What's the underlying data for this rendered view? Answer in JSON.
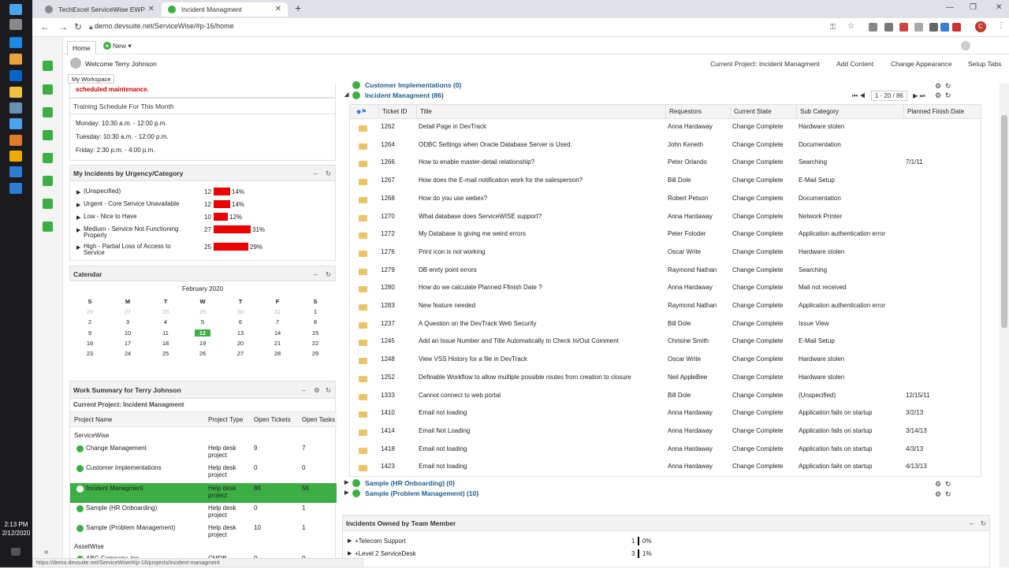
{
  "browser": {
    "tabs": [
      {
        "label": "TechExcel ServiceWise EWP",
        "active": false
      },
      {
        "label": "Incident Managment",
        "active": true
      }
    ],
    "url": "demo.devsuite.net/ServiceWise/#p-16/home",
    "profile_initial": "C"
  },
  "taskbar": {
    "time": "2:13 PM",
    "date": "2/12/2020"
  },
  "app": {
    "home_tab": "Home",
    "new_button": "New",
    "welcome": "Welcome Terry Johnson",
    "workspace_tab": "My Workspace",
    "links": {
      "current_project": "Current Project: Incident Managment",
      "add_content": "Add Content",
      "change_appearance": "Change Appearance",
      "setup_tabs": "Setup Tabs"
    }
  },
  "left": {
    "maintenance": "scheduled maintenance.",
    "training": {
      "title": "Training Schedule For This Month",
      "items": [
        "Monday: 10:30 a.m. - 12:00 p.m.",
        "Tuesday: 10:30 a.m. - 12:00 p.m.",
        "Friday: 2:30 p.m. - 4:00 p.m."
      ]
    },
    "urgency": {
      "title": "My Incidents by Urgency/Category",
      "rows": [
        {
          "label": "(Unspecified)",
          "count": "12",
          "pct": "14%",
          "value": 14
        },
        {
          "label": "Urgent - Core Service Unavailable",
          "count": "12",
          "pct": "14%",
          "value": 14
        },
        {
          "label": "Low - Nice to Have",
          "count": "10",
          "pct": "12%",
          "value": 12
        },
        {
          "label": "Medium - Service Not Functioning Properly",
          "count": "27",
          "pct": "31%",
          "value": 31
        },
        {
          "label": "High - Partial Loss of Access to Service",
          "count": "25",
          "pct": "29%",
          "value": 29
        }
      ]
    },
    "calendar": {
      "title": "Calendar",
      "month": "February 2020",
      "days": [
        "S",
        "M",
        "T",
        "W",
        "T",
        "F",
        "S"
      ],
      "weeks": [
        [
          "26",
          "27",
          "28",
          "29",
          "30",
          "31",
          "1"
        ],
        [
          "2",
          "3",
          "4",
          "5",
          "6",
          "7",
          "8"
        ],
        [
          "9",
          "10",
          "11",
          "12",
          "13",
          "14",
          "15"
        ],
        [
          "16",
          "17",
          "18",
          "19",
          "20",
          "21",
          "22"
        ],
        [
          "23",
          "24",
          "25",
          "26",
          "27",
          "28",
          "29"
        ]
      ],
      "today": "12"
    },
    "work": {
      "title": "Work Summary for Terry Johnson",
      "current": "Current Project: Incident Managment",
      "headers": [
        "Project Name",
        "Project Type",
        "Open Tickets",
        "Open Tasks"
      ],
      "group1": "ServiceWise",
      "rows": [
        {
          "name": "Change Management",
          "type": "Help desk project",
          "tickets": "9",
          "tasks": "7"
        },
        {
          "name": "Customer Implementations",
          "type": "Help desk project",
          "tickets": "0",
          "tasks": "0"
        },
        {
          "name": "Incident Managment",
          "type": "Help desk project",
          "tickets": "86",
          "tasks": "56"
        },
        {
          "name": "Sample (HR Onboarding)",
          "type": "Help desk project",
          "tickets": "0",
          "tasks": "1"
        },
        {
          "name": "Sample (Problem Management)",
          "type": "Help desk project",
          "tickets": "10",
          "tasks": "1"
        }
      ],
      "group2": "AssetWise",
      "row_asset": {
        "name": "ABC Company, Inc",
        "type": "CMDB",
        "tickets": "0",
        "tasks": "0"
      }
    }
  },
  "main": {
    "projects_top": [
      "Customer Implementations (0)",
      "Incident Managment (86)"
    ],
    "pager": "1 - 20 / 86",
    "columns": [
      "Ticket ID",
      "Title",
      "Requestors",
      "Current State",
      "Sub Category",
      "Planned Finish Date"
    ],
    "rows": [
      [
        "1262",
        "Detail Page in DevTrack",
        "Anna Hardaway",
        "Change Complete",
        "Hardware stolen",
        ""
      ],
      [
        "1264",
        "ODBC Settings when Oracle Database Server is Used.",
        "John Keneth",
        "Change Complete",
        "Documentation",
        ""
      ],
      [
        "1266",
        "How to enable master-detail relationship?",
        "Peter Orlando",
        "Change Complete",
        "Searching",
        "7/1/11"
      ],
      [
        "1267",
        "How does the E-mail notification work for the salesperson?",
        "Bill Dole",
        "Change Complete",
        "E-Mail Setup",
        ""
      ],
      [
        "1268",
        "How do you use webex?",
        "Robert Petson",
        "Change Complete",
        "Documentation",
        ""
      ],
      [
        "1270",
        "What database does ServiceWISE support?",
        "Anna Hardaway",
        "Change Complete",
        "Network Printer",
        ""
      ],
      [
        "1272",
        "My Database is giving me weird errors",
        "Peter Foloder",
        "Change Complete",
        "Application authentication error",
        ""
      ],
      [
        "1276",
        "Print icon is not working",
        "Oscar Write",
        "Change Complete",
        "Hardware stolen",
        ""
      ],
      [
        "1279",
        "DB enrty point errors",
        "Raymond Nathan",
        "Change Complete",
        "Searching",
        ""
      ],
      [
        "1280",
        "How do we calculate Planned Ffinish Date ?",
        "Anna Hardaway",
        "Change Complete",
        "Mail not received",
        ""
      ],
      [
        "1283",
        "New feature needed",
        "Raymond Nathan",
        "Change Complete",
        "Application authentication error",
        ""
      ],
      [
        "1237",
        "A Question on the DevTrack Web Security",
        "Bill Dole",
        "Change Complete",
        "Issue View",
        ""
      ],
      [
        "1245",
        "Add an Issue Number and Title Automatically to Check In/Out Comment",
        "Chrisine Smith",
        "Change Complete",
        "E-Mail Setup",
        ""
      ],
      [
        "1248",
        "View VSS History for a file in DevTrack",
        "Oscar Write",
        "Change Complete",
        "Hardware stolen",
        ""
      ],
      [
        "1252",
        "Definable Workflow to allow multiple possible routes from creation to closure",
        "Neil AppleBee",
        "Change Complete",
        "Hardware stolen",
        ""
      ],
      [
        "1333",
        "Cannot connect to web portal",
        "Bill Dole",
        "Change Complete",
        "(Unspecified)",
        "12/15/11"
      ],
      [
        "1410",
        "Email not loading",
        "Anna Hardaway",
        "Change Complete",
        "Application fails on startup",
        "3/2/13"
      ],
      [
        "1414",
        "Email Not Loading",
        "Anna Hardaway",
        "Change Complete",
        "Application fails on startup",
        "3/14/13"
      ],
      [
        "1418",
        "Email not loading",
        "Anna Hardaway",
        "Change Complete",
        "Application fails on startup",
        "4/3/13"
      ],
      [
        "1423",
        "Email not loading",
        "Anna Hardaway",
        "Change Complete",
        "Application fails on startup",
        "4/13/13"
      ]
    ],
    "projects_bottom": [
      "Sample (HR Onboarding) (0)",
      "Sample (Problem Management) (10)"
    ],
    "owned": {
      "title": "Incidents Owned by Team Member",
      "rows": [
        {
          "label": "+Telecom Support",
          "count": "1",
          "pct": "0%"
        },
        {
          "label": "+Level 2 ServiceDesk",
          "count": "3",
          "pct": "1%"
        }
      ]
    }
  },
  "status_url": "https://demo.devsuite.net/ServiceWise/#/p-16/projects/incident-managment"
}
